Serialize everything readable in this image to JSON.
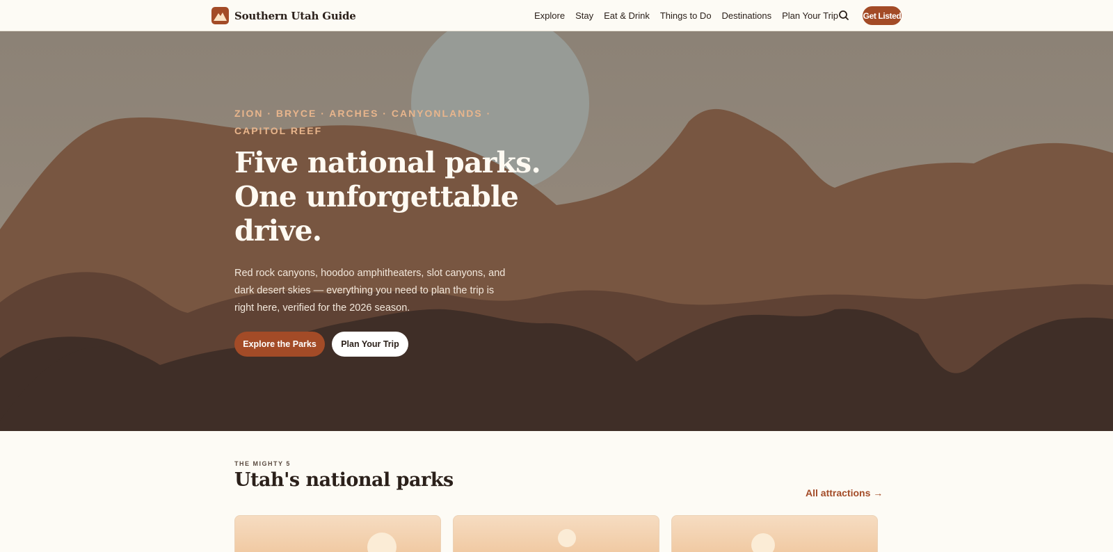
{
  "header": {
    "brand": "Southern Utah Guide",
    "nav": [
      "Explore",
      "Stay",
      "Eat & Drink",
      "Things to Do",
      "Destinations",
      "Plan Your Trip"
    ],
    "cta": "Get Listed"
  },
  "hero": {
    "eyebrow": "ZION · BRYCE · ARCHES · CANYONLANDS · CAPITOL REEF",
    "title": "Five national parks. One unforgettable drive.",
    "subtitle": "Red rock canyons, hoodoo amphitheaters, slot canyons, and dark desert skies — everything you need to plan the trip is right here, verified for the 2026 season.",
    "primary_button": "Explore the Parks",
    "secondary_button": "Plan Your Trip"
  },
  "parks_section": {
    "eyebrow": "THE MIGHTY 5",
    "title": "Utah's national parks",
    "link": "All attractions →"
  },
  "colors": {
    "accent": "#a34b27",
    "page_background": "#fdfbf5",
    "eyebrow": "#e8b58c"
  }
}
